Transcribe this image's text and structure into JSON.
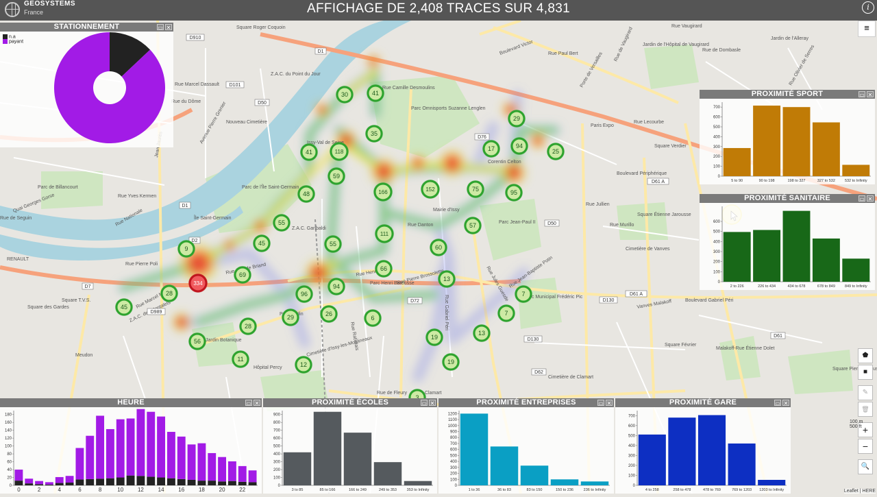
{
  "header": {
    "logo_name": "GEOSYSTEMS",
    "logo_sub": "France",
    "title": "AFFICHAGE DE 2,408 TRACES SUR 4,831",
    "info": "i"
  },
  "map": {
    "place_labels": [
      "Rue Marcel Dassault",
      "Rue du Dôme",
      "Z.A.C. du Point du Jour",
      "Square Roger Coquoin",
      "Nouveau Cimetière",
      "Issy-Val de Seine",
      "Rue Camille Desmoulins",
      "Parc Omnisports Suzanne Lenglen",
      "Corentin Celton",
      "Porte de Versailles",
      "Paris Expo",
      "Rue Lecourbe",
      "Jardin de l'Hôpital de Vaugirard",
      "Rue de Dombasle",
      "Jardin de l'Alleray",
      "Boulevard Victor",
      "Rue Vaugirard",
      "Boulevard Périphérique",
      "Parc de Billancourt",
      "Rue Yves Kermen",
      "Rue Nationale",
      "Parc de l'Île Saint-Germain",
      "Île Saint-Germain",
      "Quai Georges Gorse",
      "Rue Pierre Poli",
      "Z.A.C. Garibaldi",
      "Mairie d'Issy",
      "Rue Danton",
      "Parc Jean-Paul II",
      "Rue Jullien",
      "Rue Murillo",
      "Square Étienne Jarousse",
      "Cimetière de Vanves",
      "RENAULT",
      "Rue Aristide Briand",
      "Rue Marcel Miquel",
      "Rue Henri Tariel",
      "Rue Pierre Brossolette",
      "Parc Henri Barbusse",
      "Parc Rodin",
      "Rue Rabelais",
      "Rue Gabriel Péri",
      "Rue Jules Guesde",
      "Rue Jean-Baptiste Potin",
      "Parc Municipal Frédéric Pic",
      "Vanves Malakoff",
      "Boulevard Gabriel Péri",
      "Square des Gardes",
      "Square T.V.S.",
      "Z.A.C. des Montalets",
      "Jardin Botanique",
      "Cimetière d'Issy-les-Moulineaux",
      "Hôpital Percy",
      "Meudon",
      "Clamart",
      "Rue de Fleury",
      "Cimetière de Clamart",
      "Malakoff-Rue Étienne Dolet",
      "Square Février",
      "Square Pierre Larousse",
      "Jean Jaurès",
      "Avenue Pierre Grenier",
      "Rue de Seguin",
      "Rue Paul Bert",
      "Rue de Vaugirard",
      "Square Verdier",
      "Rue Olivier de Serres"
    ],
    "road_badges": [
      "D910",
      "D101",
      "D50",
      "D1",
      "D7",
      "D989",
      "D76",
      "D72",
      "D50",
      "D130",
      "D130",
      "D61 A",
      "D61 A",
      "D61",
      "D62",
      "D1",
      "D2"
    ],
    "clusters": [
      {
        "v": "30"
      },
      {
        "v": "41"
      },
      {
        "v": "35"
      },
      {
        "v": "41"
      },
      {
        "v": "118"
      },
      {
        "v": "59"
      },
      {
        "v": "48"
      },
      {
        "v": "166"
      },
      {
        "v": "152"
      },
      {
        "v": "75"
      },
      {
        "v": "29"
      },
      {
        "v": "17"
      },
      {
        "v": "94"
      },
      {
        "v": "25"
      },
      {
        "v": "95"
      },
      {
        "v": "57"
      },
      {
        "v": "55"
      },
      {
        "v": "45"
      },
      {
        "v": "9"
      },
      {
        "v": "55"
      },
      {
        "v": "111"
      },
      {
        "v": "60"
      },
      {
        "v": "334"
      },
      {
        "v": "69"
      },
      {
        "v": "28"
      },
      {
        "v": "45"
      },
      {
        "v": "96"
      },
      {
        "v": "94"
      },
      {
        "v": "66"
      },
      {
        "v": "13"
      },
      {
        "v": "7"
      },
      {
        "v": "7"
      },
      {
        "v": "29"
      },
      {
        "v": "26"
      },
      {
        "v": "6"
      },
      {
        "v": "28"
      },
      {
        "v": "56"
      },
      {
        "v": "11"
      },
      {
        "v": "12"
      },
      {
        "v": "19"
      },
      {
        "v": "13"
      },
      {
        "v": "19"
      },
      {
        "v": "3"
      }
    ],
    "colors": {
      "cluster_green": "#2ea32e",
      "cluster_red": "#c0151e",
      "heat_hot": "#e8262b",
      "heat_mid": "#f2e53a",
      "heat_low": "#62c84e"
    }
  },
  "panels": {
    "stationnement": {
      "title": "STATIONNEMENT",
      "legend": [
        {
          "label": "n.a",
          "color": "#222222"
        },
        {
          "label": "payant",
          "color": "#a21be6"
        }
      ]
    },
    "sport": {
      "title": "PROXIMITÉ SPORT"
    },
    "sanitaire": {
      "title": "PROXIMITÉ SANITAIRE"
    },
    "heure": {
      "title": "HEURE"
    },
    "ecoles": {
      "title": "PROXIMITÉ ÉCOLES"
    },
    "entreprises": {
      "title": "PROXIMITÉ ENTREPRISES"
    },
    "gare": {
      "title": "PROXIMITÉ GARE"
    }
  },
  "controls": {
    "menu": "≡",
    "polygon": "⬟",
    "square": "■",
    "edit": "✎",
    "trash": "🗑",
    "zoom_in": "+",
    "zoom_out": "−",
    "search": "🔍",
    "scale_top": "100 m",
    "scale_bottom": "500 ft",
    "attribution": "Leaflet | HERE"
  },
  "chart_data": [
    {
      "id": "stationnement",
      "type": "pie",
      "title": "STATIONNEMENT",
      "categories": [
        "n.a",
        "payant"
      ],
      "values": [
        13,
        87
      ],
      "colors": [
        "#222222",
        "#a21be6"
      ],
      "donut": true
    },
    {
      "id": "sport",
      "type": "bar",
      "title": "PROXIMITÉ SPORT",
      "categories": [
        "5 to 90",
        "90 to 198",
        "198 to 327",
        "327 to 532",
        "532 to Infinity"
      ],
      "values": [
        285,
        715,
        700,
        545,
        115
      ],
      "ylim": [
        0,
        750
      ],
      "yticks": [
        0,
        100,
        200,
        300,
        400,
        500,
        600,
        700
      ],
      "color": "#c07b06"
    },
    {
      "id": "sanitaire",
      "type": "bar",
      "title": "PROXIMITÉ SANITAIRE",
      "categories": [
        "2 to 226",
        "226 to 434",
        "434 to 678",
        "678 to 849",
        "849 to Infinity"
      ],
      "values": [
        495,
        515,
        705,
        430,
        230
      ],
      "ylim": [
        0,
        750
      ],
      "yticks": [
        0,
        100,
        200,
        300,
        400,
        500,
        600
      ],
      "color": "#186818"
    },
    {
      "id": "heure",
      "type": "bar",
      "title": "HEURE",
      "categories": [
        "0",
        "1",
        "2",
        "3",
        "4",
        "5",
        "6",
        "7",
        "8",
        "9",
        "10",
        "11",
        "12",
        "13",
        "14",
        "15",
        "16",
        "17",
        "18",
        "19",
        "20",
        "21",
        "22",
        "23"
      ],
      "series": [
        {
          "name": "n.a",
          "values": [
            12,
            5,
            3,
            2,
            6,
            7,
            15,
            16,
            17,
            18,
            20,
            25,
            24,
            22,
            20,
            18,
            16,
            14,
            12,
            12,
            10,
            11,
            9,
            8
          ]
        },
        {
          "name": "payant",
          "values": [
            28,
            12,
            8,
            6,
            15,
            17,
            80,
            110,
            160,
            125,
            148,
            145,
            170,
            165,
            155,
            118,
            108,
            90,
            95,
            70,
            62,
            50,
            40,
            30
          ]
        }
      ],
      "ylim": [
        0,
        190
      ],
      "yticks": [
        0,
        20,
        40,
        60,
        80,
        100,
        120,
        140,
        160,
        180
      ],
      "xticks": [
        "0",
        "2",
        "4",
        "6",
        "8",
        "10",
        "12",
        "14",
        "16",
        "18",
        "20",
        "22"
      ],
      "colors": [
        "#222222",
        "#a21be6"
      ]
    },
    {
      "id": "ecoles",
      "type": "bar",
      "title": "PROXIMITÉ ÉCOLES",
      "categories": [
        "3 to 85",
        "85 to 166",
        "166 to 249",
        "249 to 353",
        "353 to Infinity"
      ],
      "values": [
        420,
        935,
        670,
        295,
        55
      ],
      "ylim": [
        0,
        950
      ],
      "yticks": [
        0,
        100,
        200,
        300,
        400,
        500,
        600,
        700,
        800,
        900
      ],
      "color": "#555a5e"
    },
    {
      "id": "entreprises",
      "type": "bar",
      "title": "PROXIMITÉ ENTREPRISES",
      "categories": [
        "1 to 36",
        "36 to 83",
        "83 to 150",
        "150 to 236",
        "236 to Infinity"
      ],
      "values": [
        1200,
        650,
        330,
        100,
        65
      ],
      "ylim": [
        0,
        1250
      ],
      "yticks": [
        0,
        100,
        200,
        300,
        400,
        500,
        600,
        700,
        800,
        900,
        1000,
        1100,
        1200
      ],
      "color": "#0a9fc4"
    },
    {
      "id": "gare",
      "type": "bar",
      "title": "PROXIMITÉ GARE",
      "categories": [
        "4 to 258",
        "258 to 478",
        "478 to 769",
        "769 to 1203",
        "1203 to Infinity"
      ],
      "values": [
        510,
        680,
        705,
        420,
        55
      ],
      "ylim": [
        0,
        750
      ],
      "yticks": [
        0,
        100,
        200,
        300,
        400,
        500,
        600,
        700
      ],
      "color": "#0d2fc2"
    }
  ]
}
